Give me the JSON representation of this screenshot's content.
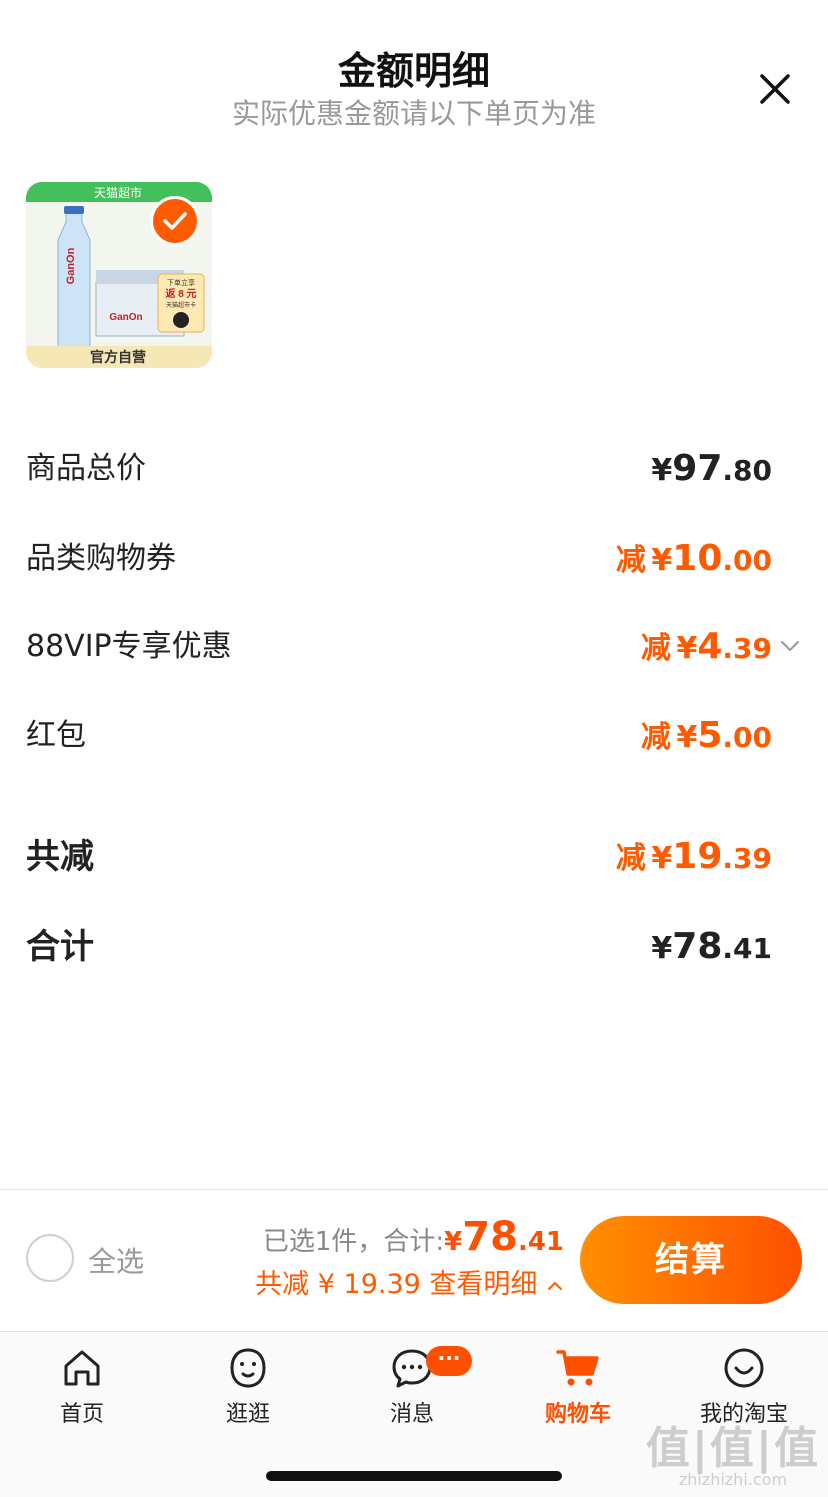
{
  "header": {
    "title": "金额明细",
    "subtitle": "实际优惠金额请以下单页为准"
  },
  "product": {
    "tag_top": "天猫超市",
    "brand_text": "GanOn",
    "promo_line1": "下单立享",
    "promo_line2": "返 8 元",
    "promo_line3": "天猫超市卡",
    "tag_bottom": "官方自营"
  },
  "rows": [
    {
      "label": "商品总价",
      "prefix": "",
      "currency": "¥",
      "int": "97",
      "dec": ".80"
    },
    {
      "label": "品类购物券",
      "prefix": "减",
      "currency": "¥",
      "int": "10",
      "dec": ".00"
    },
    {
      "label": "88VIP专享优惠",
      "prefix": "减",
      "currency": "¥",
      "int": "4",
      "dec": ".39"
    },
    {
      "label": "红包",
      "prefix": "减",
      "currency": "¥",
      "int": "5",
      "dec": ".00"
    },
    {
      "label": "共减",
      "prefix": "减",
      "currency": "¥",
      "int": "19",
      "dec": ".39"
    },
    {
      "label": "合计",
      "prefix": "",
      "currency": "¥",
      "int": "78",
      "dec": ".41"
    }
  ],
  "checkout": {
    "select_all": "全选",
    "selected_text": "已选1件，合计:",
    "total_currency": "¥",
    "total_int": "78",
    "total_dec": ".41",
    "discount_text": "共减 ¥ 19.39",
    "detail_link": "查看明细",
    "pay_button": "结算"
  },
  "tabbar": {
    "items": [
      {
        "label": "首页",
        "icon": "home-icon"
      },
      {
        "label": "逛逛",
        "icon": "explore-icon"
      },
      {
        "label": "消息",
        "icon": "message-icon",
        "badge": "···"
      },
      {
        "label": "购物车",
        "icon": "cart-icon",
        "active": true
      },
      {
        "label": "我的淘宝",
        "icon": "profile-icon"
      }
    ]
  },
  "watermark": {
    "logo": "值|值|值",
    "url": "zhizhizhi.com"
  },
  "colors": {
    "accent": "#ff5000",
    "discount": "#ff5a00",
    "pay_gradient_start": "#ff9000",
    "pay_gradient_end": "#ff5000"
  }
}
